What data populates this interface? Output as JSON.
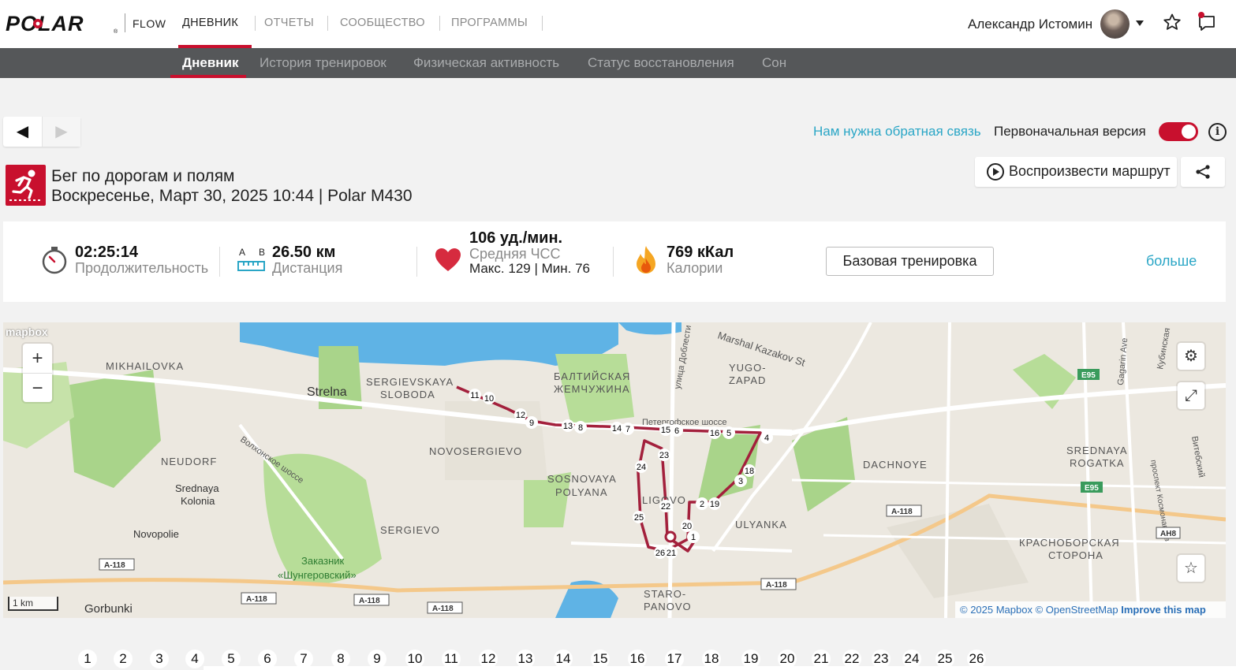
{
  "brand": {
    "logo_text": "POLAR.",
    "product": "FLOW",
    "accent": "#c8102e",
    "link_color": "#2aa6c6"
  },
  "topnav": {
    "items": [
      "ДНЕВНИК",
      "ОТЧЕТЫ",
      "СООБЩЕСТВО",
      "ПРОГРАММЫ"
    ],
    "active": "ДНЕВНИК"
  },
  "user": {
    "name": "Александр Истомин"
  },
  "subnav": {
    "items": [
      "Дневник",
      "История тренировок",
      "Физическая активность",
      "Статус восстановления",
      "Сон"
    ],
    "active": "Дневник"
  },
  "pager": {
    "prev": "◀",
    "next": "▶"
  },
  "feedback_link": "Нам нужна обратная связь",
  "version_label": "Первоначальная версия",
  "version_toggle_on": true,
  "session": {
    "sport": "Бег по дорогам и полям",
    "datetime_device": "Воскресенье, Март 30, 2025 10:44 | Polar M430",
    "play_route": "Воспроизвести маршрут"
  },
  "summary": {
    "duration": {
      "value": "02:25:14",
      "label": "Продолжительность"
    },
    "distance": {
      "value": "26.50 км",
      "label": "Дистанция",
      "icon_a": "A",
      "icon_b": "B"
    },
    "heart_rate": {
      "value": "106 уд./мин.",
      "label": "Средняя ЧСС",
      "minmax": "Макс. 129  |  Мин. 76"
    },
    "calories": {
      "value": "769 кКал",
      "label": "Калории"
    },
    "benefit_button": "Базовая тренировка",
    "more_link": "больше"
  },
  "map": {
    "mapbox_logo": "mapbox",
    "zoom_in": "+",
    "zoom_out": "−",
    "scale": "1 km",
    "attribution": {
      "copy_mapbox": "© 2025 Mapbox",
      "copy_osm": "© OpenStreetMap",
      "improve": "Improve this map"
    },
    "places": [
      "MIKHAILOVKA",
      "Strelna",
      "SERGIEVSKAYA",
      "SLOBODA",
      "БАЛТИЙСКАЯ",
      "ЖЕМЧУЖИНА",
      "YUGO-",
      "ZAPAD",
      "Marshal Kazakov St",
      "улица Доблести",
      "Петергофское шоссе",
      "NEUDORF",
      "Srednaya",
      "Kolonia",
      "NOVOSERGIEVO",
      "SOSNOVAYA",
      "POLYANA",
      "LIGOVO",
      "DACHNOYE",
      "SREDNAYA",
      "ROGATKA",
      "ULYANKA",
      "Novopolie",
      "SERGIEVO",
      "Заказник",
      "«Шунгеровский»",
      "КРАСНОБОРСКАЯ",
      "СТОРОНА",
      "Gorbunki",
      "STARO-",
      "PANOVO",
      "Волхонское шоссе",
      "Кубинская",
      "Gagarin Ave",
      "проспект Космонавтов",
      "Витебский",
      "E95",
      "A-118",
      "AH8"
    ],
    "route_color": "#a3203c"
  },
  "laps": [
    "1",
    "2",
    "3",
    "4",
    "5",
    "6",
    "7",
    "8",
    "9",
    "10",
    "11",
    "12",
    "13",
    "14",
    "15",
    "16",
    "17",
    "18",
    "19",
    "20",
    "21",
    "22",
    "23",
    "24",
    "25",
    "26"
  ]
}
